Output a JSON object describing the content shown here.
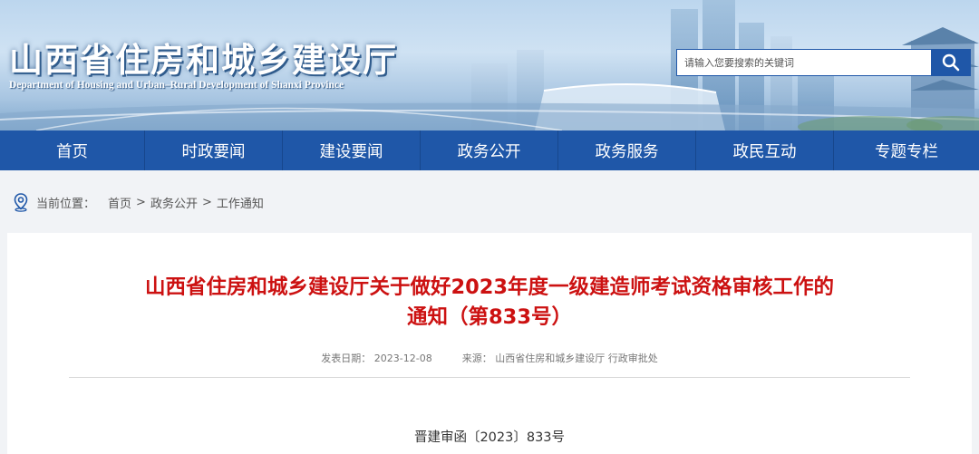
{
  "header": {
    "title": "山西省住房和城乡建设厅",
    "subtitle": "Department of Housing and Urban–Rural Development of Shanxi Province"
  },
  "search": {
    "placeholder": "请输入您要搜索的关键词",
    "icon": "search-icon"
  },
  "nav": {
    "items": [
      "首页",
      "时政要闻",
      "建设要闻",
      "政务公开",
      "政务服务",
      "政民互动",
      "专题专栏"
    ]
  },
  "breadcrumb": {
    "label": "当前位置：",
    "items": [
      "首页",
      "政务公开",
      "工作通知"
    ],
    "separator": ">",
    "icon": "location-pin-icon"
  },
  "article": {
    "title_line1": "山西省住房和城乡建设厅关于做好2023年度一级建造师考试资格审核工作的",
    "title_line2": "通知（第833号）",
    "date_label": "发表日期：",
    "date": "2023-12-08",
    "source_label": "来源：",
    "source": "山西省住房和城乡建设厅 行政审批处",
    "doc_number": "晋建审函〔2023〕833号"
  },
  "colors": {
    "nav_bg": "#1f57a8",
    "title_red": "#cc1111",
    "page_bg": "#f1f3f6"
  }
}
